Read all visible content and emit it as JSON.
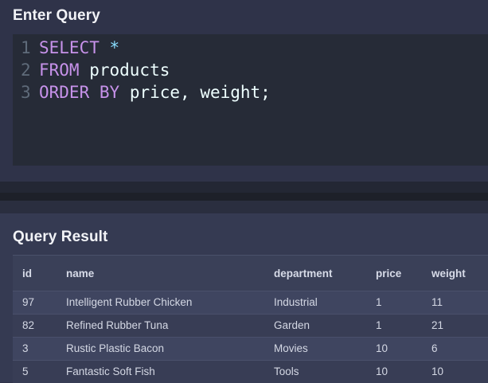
{
  "editor_section": {
    "title": "Enter Query",
    "lines": [
      {
        "number": "1",
        "tokens": [
          {
            "text": "SELECT",
            "kind": "kw"
          },
          {
            "text": " ",
            "kind": "ident"
          },
          {
            "text": "*",
            "kind": "op"
          }
        ]
      },
      {
        "number": "2",
        "tokens": [
          {
            "text": "FROM",
            "kind": "kw"
          },
          {
            "text": " products",
            "kind": "ident"
          }
        ]
      },
      {
        "number": "3",
        "tokens": [
          {
            "text": "ORDER",
            "kind": "kw"
          },
          {
            "text": " ",
            "kind": "ident"
          },
          {
            "text": "BY",
            "kind": "kw"
          },
          {
            "text": " price, weight;",
            "kind": "ident"
          }
        ]
      }
    ]
  },
  "result_section": {
    "title": "Query Result",
    "columns": [
      "id",
      "name",
      "department",
      "price",
      "weight"
    ],
    "rows": [
      {
        "id": "97",
        "name": "Intelligent Rubber Chicken",
        "department": "Industrial",
        "price": "1",
        "weight": "11"
      },
      {
        "id": "82",
        "name": "Refined Rubber Tuna",
        "department": "Garden",
        "price": "1",
        "weight": "21"
      },
      {
        "id": "3",
        "name": "Rustic Plastic Bacon",
        "department": "Movies",
        "price": "10",
        "weight": "6"
      },
      {
        "id": "5",
        "name": "Fantastic Soft Fish",
        "department": "Tools",
        "price": "10",
        "weight": "10"
      }
    ]
  },
  "colors": {
    "keyword": "#c792ea",
    "operator": "#89ddff",
    "editor_bg": "#262b37",
    "panel_bg": "#2f3349"
  }
}
